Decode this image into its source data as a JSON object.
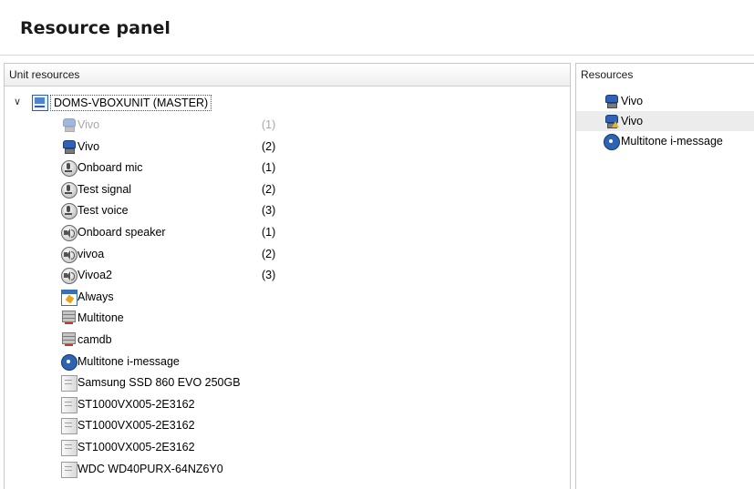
{
  "page": {
    "title": "Resource panel"
  },
  "unit_resources": {
    "header": "Unit resources",
    "root": {
      "label": "DOMS-VBOXUNIT (MASTER)",
      "icon": "unit-icon",
      "expanded": true
    },
    "items": [
      {
        "label": "Vivo",
        "count": "(1)",
        "icon": "camera-icon",
        "disabled": true
      },
      {
        "label": "Vivo",
        "count": "(2)",
        "icon": "camera-icon"
      },
      {
        "label": "Onboard mic",
        "count": "(1)",
        "icon": "microphone-icon"
      },
      {
        "label": "Test signal",
        "count": "(2)",
        "icon": "microphone-icon"
      },
      {
        "label": "Test voice",
        "count": "(3)",
        "icon": "microphone-icon"
      },
      {
        "label": "Onboard speaker",
        "count": "(1)",
        "icon": "speaker-icon"
      },
      {
        "label": "vivoa",
        "count": "(2)",
        "icon": "speaker-icon"
      },
      {
        "label": "Vivoa2",
        "count": "(3)",
        "icon": "speaker-icon"
      },
      {
        "label": "Always",
        "count": "",
        "icon": "schedule-icon"
      },
      {
        "label": "Multitone",
        "count": "",
        "icon": "server-icon"
      },
      {
        "label": "camdb",
        "count": "",
        "icon": "server-icon"
      },
      {
        "label": "Multitone i-message",
        "count": "",
        "icon": "gear-icon"
      },
      {
        "label": "Samsung SSD 860 EVO 250GB",
        "count": "",
        "icon": "disk-icon"
      },
      {
        "label": "ST1000VX005-2E3162",
        "count": "",
        "icon": "disk-icon"
      },
      {
        "label": "ST1000VX005-2E3162",
        "count": "",
        "icon": "disk-icon"
      },
      {
        "label": "ST1000VX005-2E3162",
        "count": "",
        "icon": "disk-icon"
      },
      {
        "label": "WDC WD40PURX-64NZ6Y0",
        "count": "",
        "icon": "disk-icon"
      }
    ]
  },
  "resources": {
    "header": "Resources",
    "items": [
      {
        "label": "Vivo",
        "icon": "camera-icon",
        "selected": false
      },
      {
        "label": "Vivo",
        "icon": "camera-warning-icon",
        "selected": true
      },
      {
        "label": "Multitone i-message",
        "icon": "gear-icon",
        "selected": false
      }
    ]
  },
  "colors": {
    "disabled_text": "#a8a8a8",
    "selection": "#ececec",
    "accent": "#2c63b3"
  }
}
